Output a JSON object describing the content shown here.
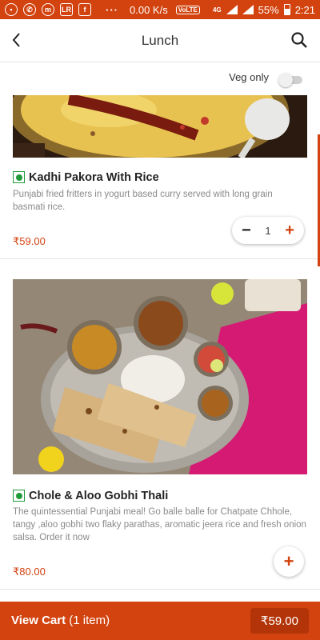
{
  "status_bar": {
    "speed": "0.00 K/s",
    "network_badge": "VoLTE",
    "network_type": "4G",
    "battery": "55%",
    "time": "2:21",
    "icons": [
      "chat-bubble-icon",
      "whatsapp-icon",
      "messenger-icon",
      "lr-icon",
      "facebook-icon"
    ]
  },
  "header": {
    "title": "Lunch",
    "back_icon": "back-arrow-icon",
    "search_icon": "search-icon"
  },
  "filter": {
    "veg_only_label": "Veg only",
    "veg_only_on": false
  },
  "items": [
    {
      "name": "Kadhi Pakora With Rice",
      "description": "Punjabi fried fritters in yogurt based curry served with long grain basmati rice.",
      "price": "₹59.00",
      "quantity": "1",
      "veg": true
    },
    {
      "name": "Chole & Aloo Gobhi Thali",
      "description": "The quintessential Punjabi meal! Go balle balle for Chatpate Chhole, tangy ,aloo gobhi two flaky parathas, aromatic jeera rice and fresh onion salsa. Order it now",
      "price": "₹80.00",
      "veg": true
    }
  ],
  "cart": {
    "label": "View Cart",
    "count": "(1 item)",
    "total": "₹59.00"
  },
  "colors": {
    "accent": "#d2430f",
    "veg_green": "#1f9b3a"
  }
}
